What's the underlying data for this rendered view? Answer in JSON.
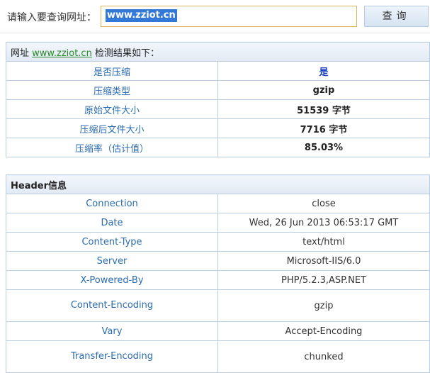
{
  "search": {
    "label": "请输入要查询网址：",
    "value": "www.zziot.cn",
    "button": "查询"
  },
  "result": {
    "prefix": "网址",
    "site": "www.zziot.cn",
    "suffix": "检测结果如下：",
    "rows": [
      {
        "key": "是否压缩",
        "value": "是"
      },
      {
        "key": "压缩类型",
        "value": "gzip"
      },
      {
        "key": "原始文件大小",
        "value": "51539 字节"
      },
      {
        "key": "压缩后文件大小",
        "value": "7716 字节"
      },
      {
        "key": "压缩率（估计值）",
        "value": "85.03%"
      }
    ]
  },
  "headers": {
    "title": "Header信息",
    "rows": [
      {
        "key": "Connection",
        "value": "close"
      },
      {
        "key": "Date",
        "value": "Wed, 26 Jun 2013 06:53:17 GMT"
      },
      {
        "key": "Content-Type",
        "value": "text/html"
      },
      {
        "key": "Server",
        "value": "Microsoft-IIS/6.0"
      },
      {
        "key": "X-Powered-By",
        "value": "PHP/5.2.3,ASP.NET"
      },
      {
        "key": "Content-Encoding",
        "value": "gzip"
      },
      {
        "key": "Vary",
        "value": "Accept-Encoding"
      },
      {
        "key": "Transfer-Encoding",
        "value": "chunked"
      }
    ]
  }
}
